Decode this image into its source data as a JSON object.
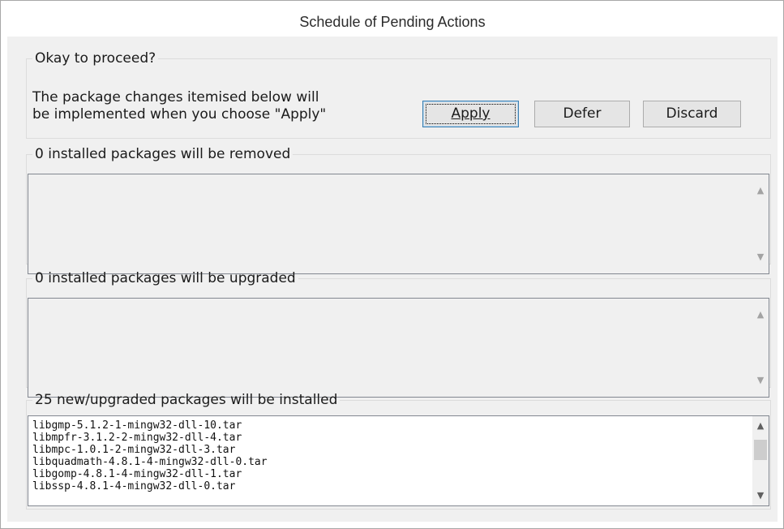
{
  "window": {
    "title": "Schedule of Pending Actions"
  },
  "proceed": {
    "legend": "Okay to proceed?",
    "description_line1": "The package changes itemised below will",
    "description_line2": "be implemented when you choose \"Apply\"",
    "buttons": {
      "apply": "Apply",
      "defer": "Defer",
      "discard": "Discard"
    }
  },
  "removed": {
    "legend": "0 installed packages will be removed",
    "items": []
  },
  "upgraded": {
    "legend": "0 installed packages will be upgraded",
    "items": []
  },
  "installed": {
    "legend": "25 new/upgraded packages will be installed",
    "items": [
      "libgmp-5.1.2-1-mingw32-dll-10.tar",
      "libmpfr-3.1.2-2-mingw32-dll-4.tar",
      "libmpc-1.0.1-2-mingw32-dll-3.tar",
      "libquadmath-4.8.1-4-mingw32-dll-0.tar",
      "libgomp-4.8.1-4-mingw32-dll-1.tar",
      "libssp-4.8.1-4-mingw32-dll-0.tar"
    ]
  },
  "icons": {
    "scroll_up": "▲",
    "scroll_down": "▼"
  }
}
